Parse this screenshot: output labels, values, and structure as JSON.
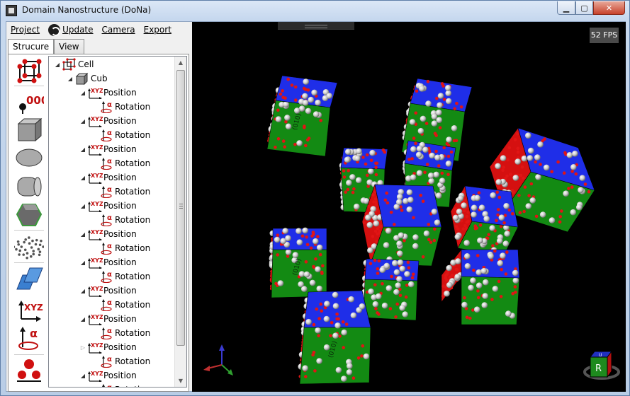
{
  "window": {
    "title": "Domain Nanostructure (DoNa)",
    "minimize_glyph": "▁",
    "maximize_glyph": "▢",
    "close_glyph": "✕"
  },
  "menu": {
    "project": "Project",
    "update": "Update",
    "camera": "Camera",
    "export": "Export"
  },
  "tabs": {
    "structure": "Strucure",
    "view": "View"
  },
  "toolbox": {
    "icons": [
      "cell-icon",
      "lattice-counter-icon",
      "cube-icon",
      "ellipsoid-icon",
      "cylinder-icon",
      "polyhedron-icon",
      "particles-icon",
      "plane-icon",
      "position-icon",
      "rotation-icon",
      "molecule-icon"
    ]
  },
  "tree": {
    "root": "Cell",
    "child": "Cub",
    "position_label": "Position",
    "rotation_label": "Rotation",
    "position_badge": "XYZ",
    "rotation_badge": "α",
    "pairs": 11
  },
  "viewport": {
    "fps": "52 FPS",
    "nav_cube_label": "R",
    "nav_cube_top": "U",
    "face_label": "(010)"
  },
  "colors": {
    "face_blue": "#1f2ee8",
    "face_red": "#d51010",
    "face_green": "#138a13",
    "sphere_gray": "#c8c8c8",
    "sphere_red": "#e01515"
  }
}
